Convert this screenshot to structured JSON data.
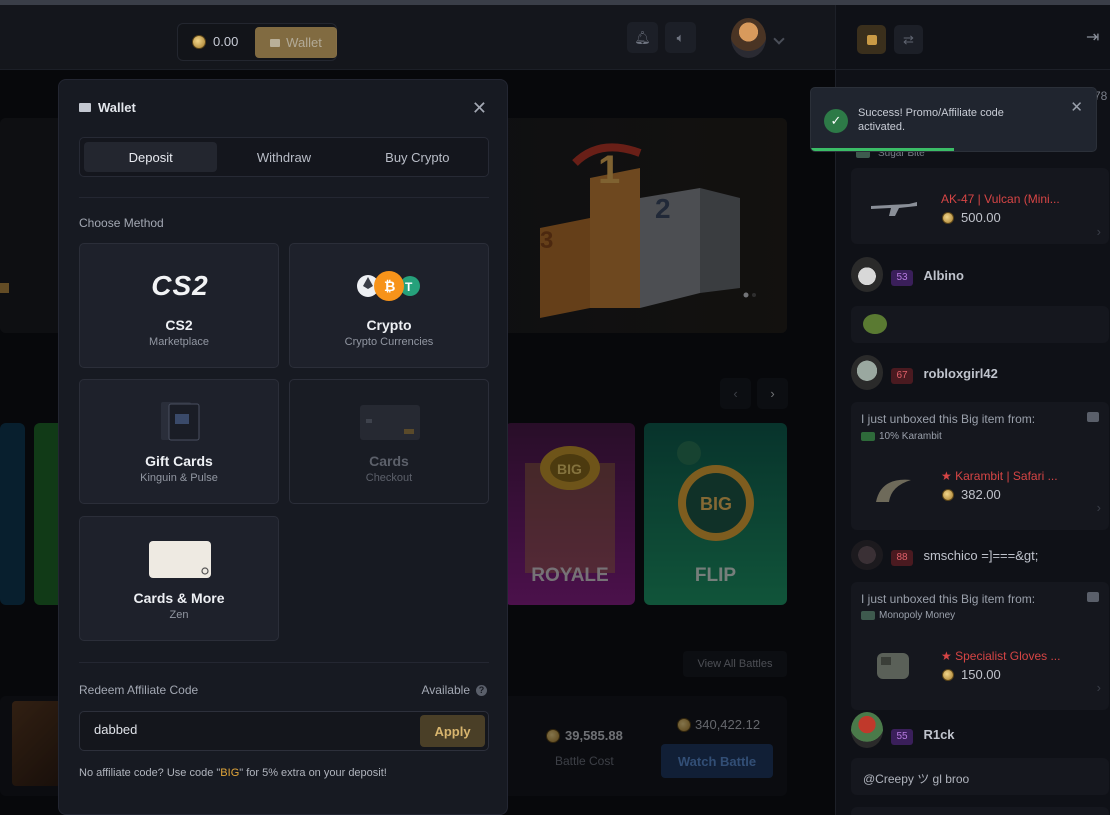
{
  "header": {
    "balance": "0.00",
    "wallet_label": "Wallet"
  },
  "background": {
    "view_all_battles": "View All Battles",
    "battle_total": "340,422.12",
    "battle_cost_value": "39,585.88",
    "battle_cost_label": "Battle Cost",
    "watch_battle": "Watch Battle",
    "game_royale": "ROYALE",
    "game_flip": "FLIP"
  },
  "modal": {
    "title": "Wallet",
    "tabs": [
      "Deposit",
      "Withdraw",
      "Buy Crypto"
    ],
    "active_tab": "Deposit",
    "choose_method": "Choose Method",
    "methods": [
      {
        "title": "CS2",
        "subtitle": "Marketplace",
        "logo": "CS2",
        "enabled": true
      },
      {
        "title": "Crypto",
        "subtitle": "Crypto Currencies",
        "enabled": true
      },
      {
        "title": "Gift Cards",
        "subtitle": "Kinguin & Pulse",
        "enabled": true
      },
      {
        "title": "Cards",
        "subtitle": "Checkout",
        "enabled": false
      },
      {
        "title": "Cards & More",
        "subtitle": "Zen",
        "enabled": true
      }
    ],
    "redeem_label": "Redeem Affiliate Code",
    "available_label": "Available",
    "code_value": "dabbed",
    "apply_label": "Apply",
    "hint_prefix": "No affiliate code? Use code \"",
    "hint_code": "BIG",
    "hint_suffix": "\" for 5% extra on your deposit!"
  },
  "toast": {
    "message": "Success! Promo/Affiliate code activated.",
    "progress": 0.5
  },
  "chat": {
    "header_partial": "78",
    "messages": [
      {
        "type": "drop",
        "source": "Sugar Bite",
        "item": "AK-47 | Vulcan (Mini...",
        "value": "500.00"
      },
      {
        "type": "user",
        "level": "53",
        "name": "Albino"
      },
      {
        "type": "user",
        "level": "67",
        "name": "robloxgirl42"
      },
      {
        "type": "drop",
        "intro": "I just unboxed this Big item from:",
        "source": "10% Karambit",
        "item": "★ Karambit | Safari ...",
        "value": "382.00"
      },
      {
        "type": "user",
        "level": "88",
        "name": "smschico =]===&gt;"
      },
      {
        "type": "drop",
        "intro": "I just unboxed this Big item from:",
        "source": "Monopoly Money",
        "item": "★ Specialist Gloves ...",
        "value": "150.00"
      },
      {
        "type": "user",
        "level": "55",
        "name": "R1ck"
      },
      {
        "type": "text",
        "text": "@Creepy ツ gl broo"
      }
    ]
  },
  "colors": {
    "accent_gold": "#a7884f",
    "success": "#3bbd67",
    "item_red": "#d64545"
  }
}
